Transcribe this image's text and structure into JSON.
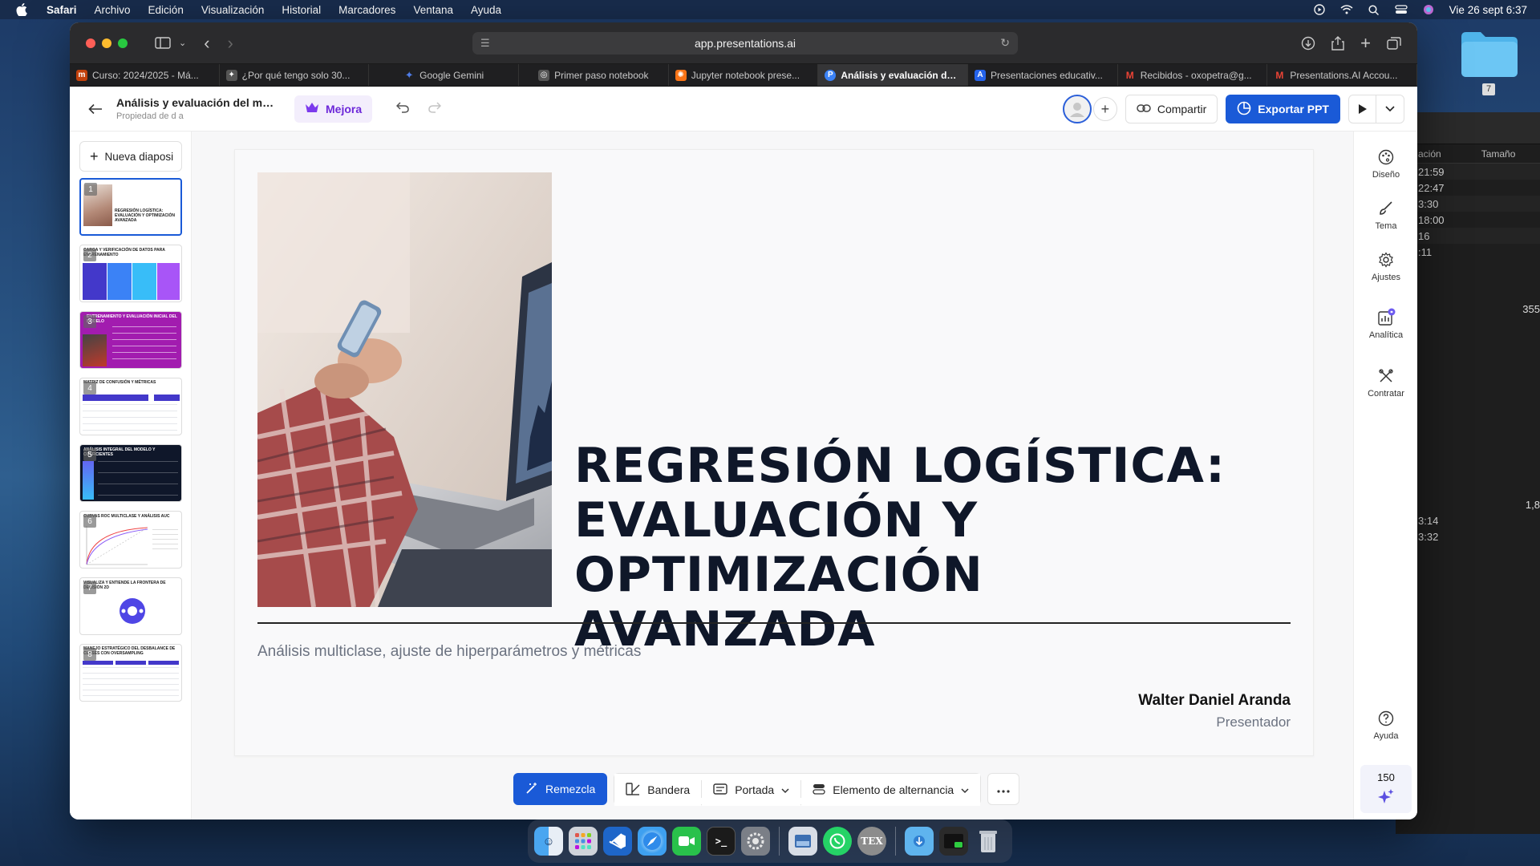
{
  "menubar": {
    "app_name": "Safari",
    "items": [
      "Archivo",
      "Edición",
      "Visualización",
      "Historial",
      "Marcadores",
      "Ventana",
      "Ayuda"
    ],
    "clock": "Vie 26 sept  6:37"
  },
  "browser": {
    "url": "app.presentations.ai",
    "tabs": [
      {
        "label": "Curso: 2024/2025 - Má...",
        "fav_color": "#c2410c",
        "fav_text": "m"
      },
      {
        "label": "¿Por qué tengo solo 30...",
        "fav_color": "#555555",
        "fav_text": "✦"
      },
      {
        "label": "Google Gemini",
        "fav_color": "#4f7de8",
        "fav_text": "✦"
      },
      {
        "label": "Primer paso notebook",
        "fav_color": "#555555",
        "fav_text": "◎"
      },
      {
        "label": "Jupyter notebook prese...",
        "fav_color": "#f97316",
        "fav_text": "✺"
      },
      {
        "label": "Análisis y evaluación del...",
        "fav_color": "#3b82f6",
        "fav_text": "P",
        "active": true
      },
      {
        "label": "Presentaciones educativ...",
        "fav_color": "#2563eb",
        "fav_text": "A"
      },
      {
        "label": "Recibidos - oxopetra@g...",
        "fav_color": "#ea4335",
        "fav_text": "M"
      },
      {
        "label": "Presentations.AI Accou...",
        "fav_color": "#ea4335",
        "fav_text": "M"
      }
    ]
  },
  "header": {
    "doc_title": "Análisis y evaluación del mo...",
    "doc_owner": "Propiedad de d a",
    "upgrade_label": "Mejora",
    "share_label": "Compartir",
    "export_label": "Exportar PPT"
  },
  "sidebar": {
    "new_slide_label": "Nueva diaposi",
    "thumbs": [
      {
        "num": "1",
        "title": "REGRESIÓN LOGÍSTICA: EVALUACIÓN Y OPTIMIZACIÓN AVANZADA"
      },
      {
        "num": "2",
        "title": "CARGA Y VERIFICACIÓN DE DATOS PARA ENTRENAMIENTO"
      },
      {
        "num": "3",
        "title": "ENTRENAMIENTO Y EVALUACIÓN INICIAL DEL MODELO"
      },
      {
        "num": "4",
        "title": "MATRIZ DE CONFUSIÓN Y MÉTRICAS"
      },
      {
        "num": "5",
        "title": "ANÁLISIS INTEGRAL DEL MODELO Y COEFICIENTES"
      },
      {
        "num": "6",
        "title": "CURVAS ROC MULTICLASE Y ANÁLISIS AUC"
      },
      {
        "num": "7",
        "title": "VISUALIZA Y ENTIENDE LA FRONTERA DE DECISIÓN 2D"
      },
      {
        "num": "8",
        "title": "MANEJO ESTRATÉGICO DEL DESBALANCE DE CLASES CON OVERSAMPLING"
      }
    ]
  },
  "slide": {
    "title": "REGRESIÓN LOGÍSTICA: EVALUACIÓN Y OPTIMIZACIÓN AVANZADA",
    "subtitle": "Análisis multiclase, ajuste de hiperparámetros y métricas",
    "presenter_name": "Walter Daniel Aranda",
    "presenter_role": "Presentador"
  },
  "bottom_toolbar": {
    "remix": "Remezcla",
    "flag": "Bandera",
    "cover": "Portada",
    "toggle": "Elemento de alternancia"
  },
  "right_rail": {
    "design": "Diseño",
    "theme": "Tema",
    "settings": "Ajustes",
    "analytics": "Analítica",
    "hire": "Contratar",
    "help": "Ayuda",
    "credits": "150"
  },
  "background_finder": {
    "col_date": "ación",
    "col_size": "Tamaño",
    "rows": [
      "21:59",
      "22:47",
      "3:30",
      "18:00",
      "16",
      ":11"
    ],
    "extra_rows": [
      "3:14",
      "3:32"
    ],
    "side_values": [
      "355",
      "1,8"
    ],
    "folder_badge": "7"
  },
  "colors": {
    "accent": "#1a5ad7",
    "upgrade": "#6d28d9"
  }
}
